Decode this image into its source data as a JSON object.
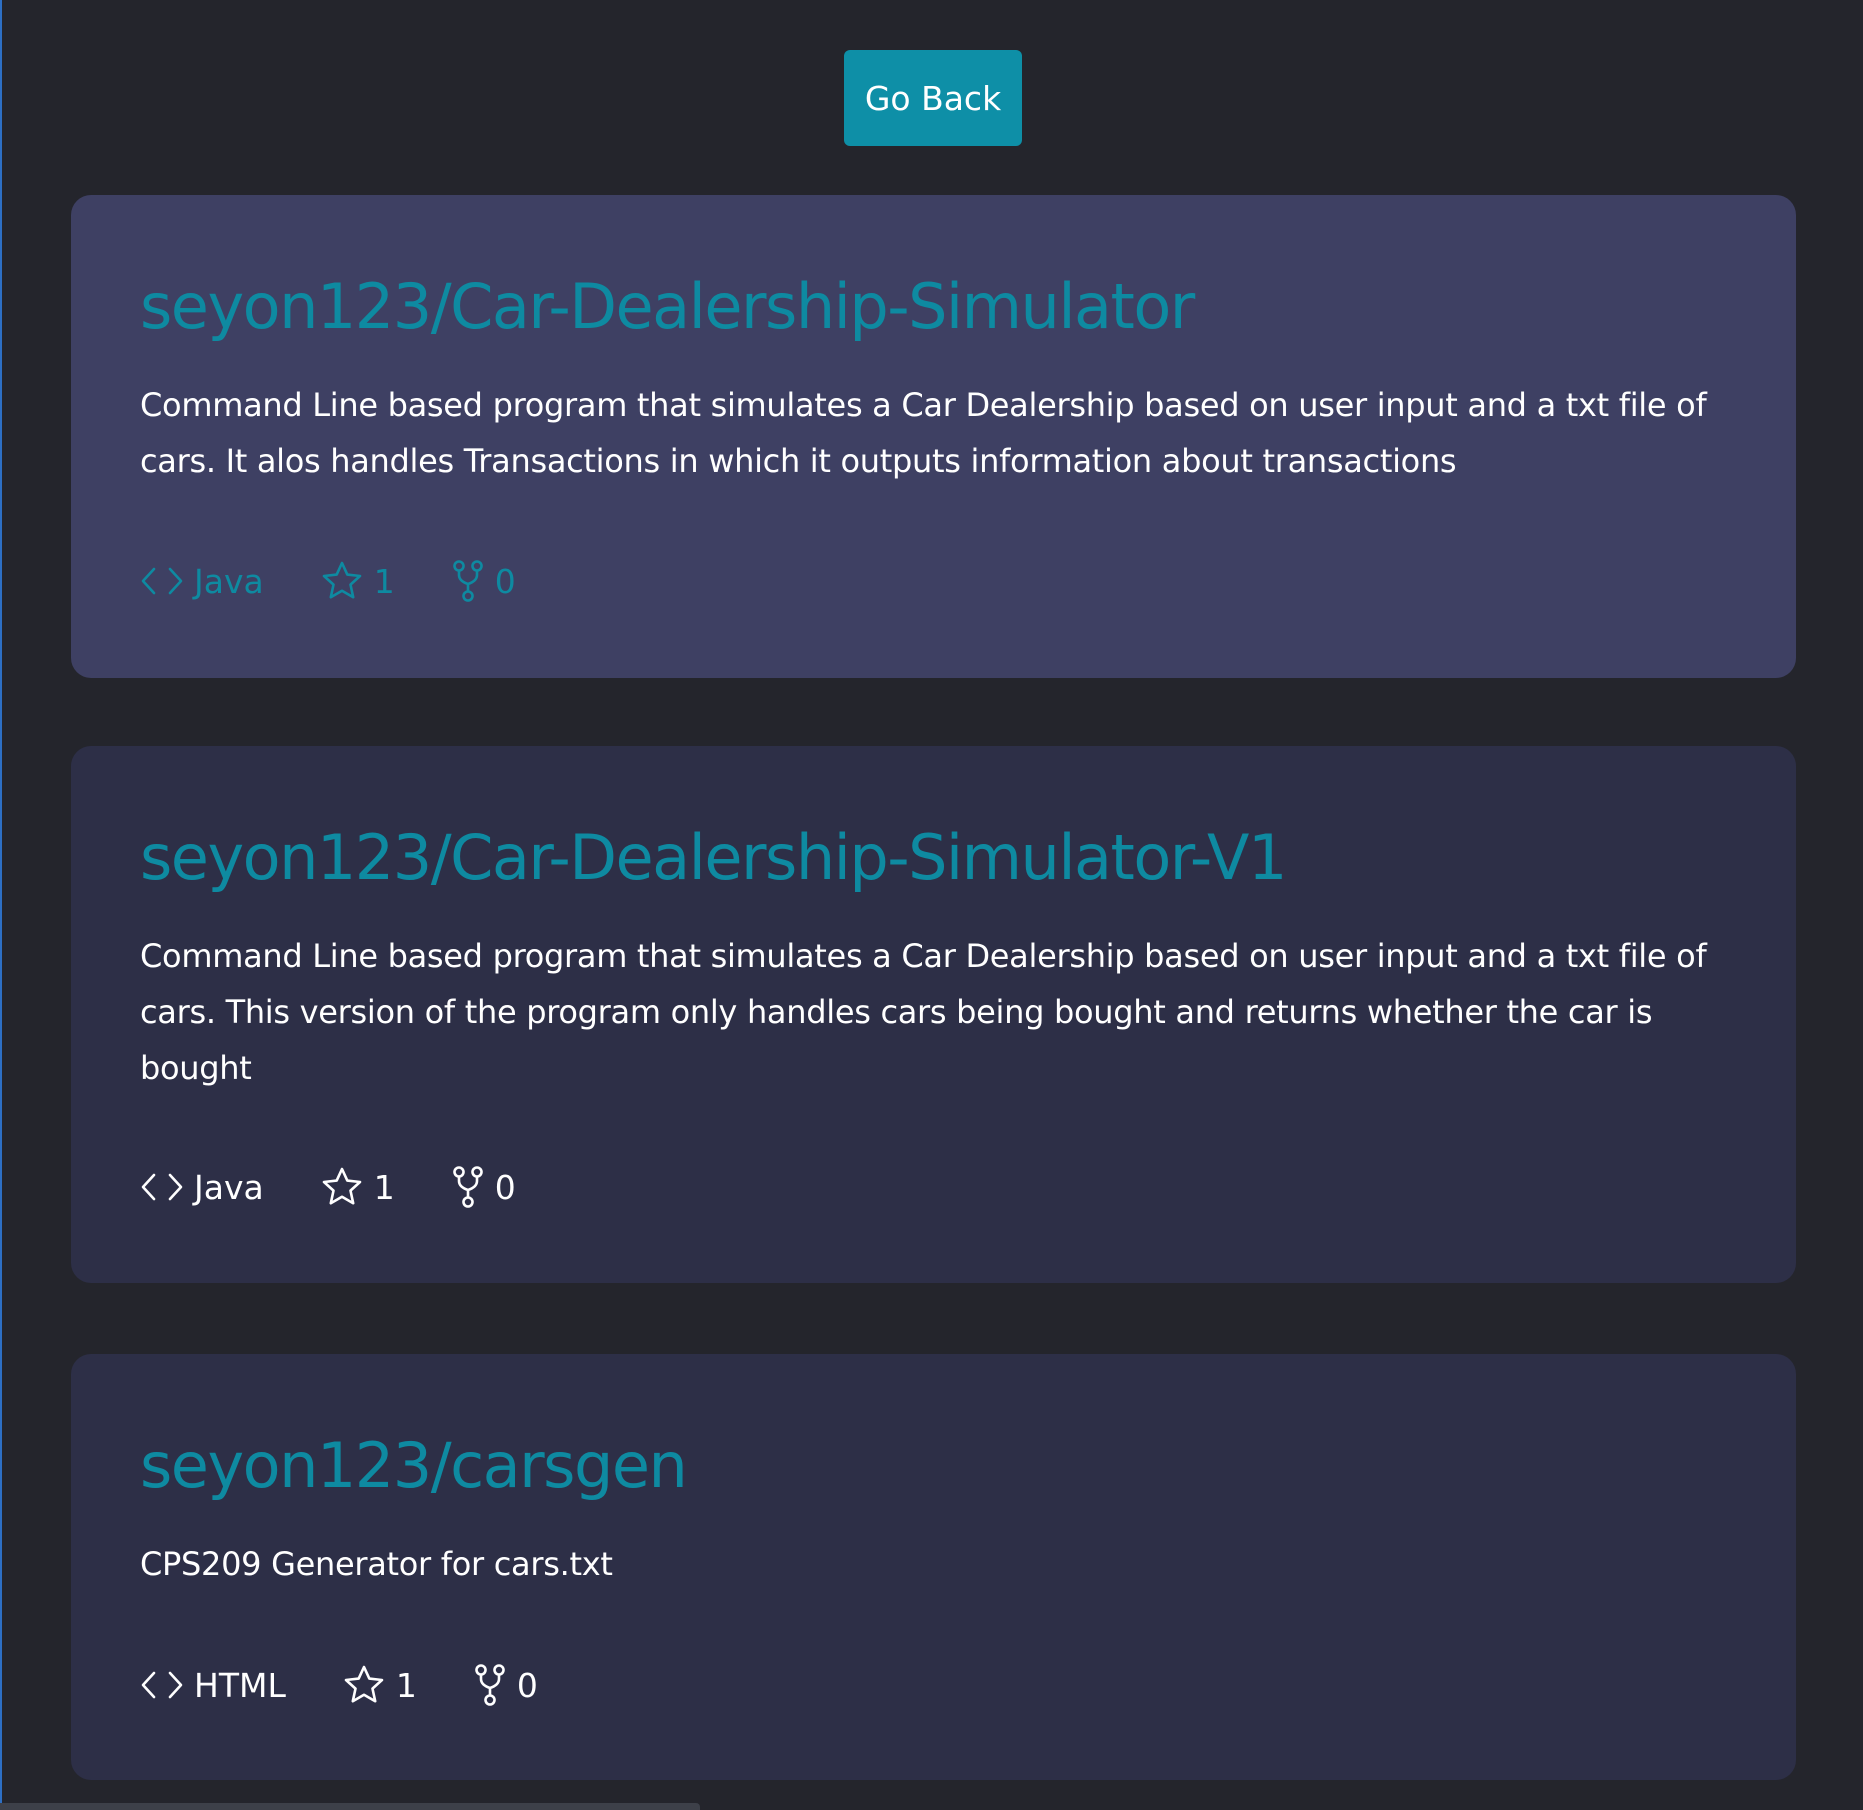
{
  "go_back_label": "Go Back",
  "repos": [
    {
      "title": "seyon123/Car-Dealership-Simulator",
      "description": "Command Line based program that simulates a Car Dealership based on user input and a txt file of cars. It alos handles Transactions in which it outputs information about transactions",
      "language": "Java",
      "stars": "1",
      "forks": "0",
      "hovered": true
    },
    {
      "title": "seyon123/Car-Dealership-Simulator-V1",
      "description": "Command Line based program that simulates a Car Dealership based on user input and a txt file of cars. This version of the program only handles cars being bought and returns whether the car is bought",
      "language": "Java",
      "stars": "1",
      "forks": "0",
      "hovered": false
    },
    {
      "title": "seyon123/carsgen",
      "description": "CPS209 Generator for cars.txt",
      "language": "HTML",
      "stars": "1",
      "forks": "0",
      "hovered": false
    }
  ],
  "colors": {
    "background": "#24252c",
    "card_hover": "#3e4063",
    "card": "#2d2f47",
    "accent": "#0e8fa7",
    "title": "#0e8aa1"
  },
  "icons": {
    "language": "code-icon",
    "stars": "star-icon",
    "forks": "fork-icon"
  }
}
